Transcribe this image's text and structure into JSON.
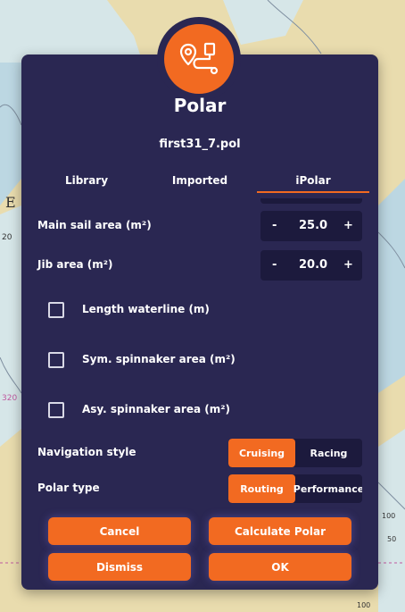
{
  "dialog": {
    "title": "Polar",
    "filename": "first31_7.pol",
    "tabs": [
      {
        "label": "Library",
        "active": false
      },
      {
        "label": "Imported",
        "active": false
      },
      {
        "label": "iPolar",
        "active": true
      }
    ],
    "main_sail": {
      "label": "Main sail area (m²)",
      "minus": "-",
      "value": "25.0",
      "plus": "+"
    },
    "jib": {
      "label": "Jib area (m²)",
      "minus": "-",
      "value": "20.0",
      "plus": "+"
    },
    "options": [
      {
        "label": "Length waterline (m)",
        "checked": false
      },
      {
        "label": "Sym. spinnaker area (m²)",
        "checked": false
      },
      {
        "label": "Asy. spinnaker area (m²)",
        "checked": false
      }
    ],
    "navigation_style": {
      "label": "Navigation style",
      "options": [
        "Cruising",
        "Racing"
      ],
      "selected": "Cruising"
    },
    "polar_type": {
      "label": "Polar type",
      "options": [
        "Routing",
        "Performance"
      ],
      "selected": "Routing"
    },
    "buttons": {
      "cancel": "Cancel",
      "calculate": "Calculate Polar",
      "dismiss": "Dismiss",
      "ok": "OK"
    }
  },
  "chart_background": {
    "labels": [
      "E",
      "20",
      "320",
      "100",
      "50",
      "100"
    ]
  },
  "colors": {
    "accent": "#f26a21",
    "dialog_bg": "#2a2752",
    "field_bg": "#1c1a3d",
    "land": "#e9dcae",
    "shallow_water": "#bcd7e2"
  },
  "icons": {
    "logo": "route-polar-icon"
  }
}
